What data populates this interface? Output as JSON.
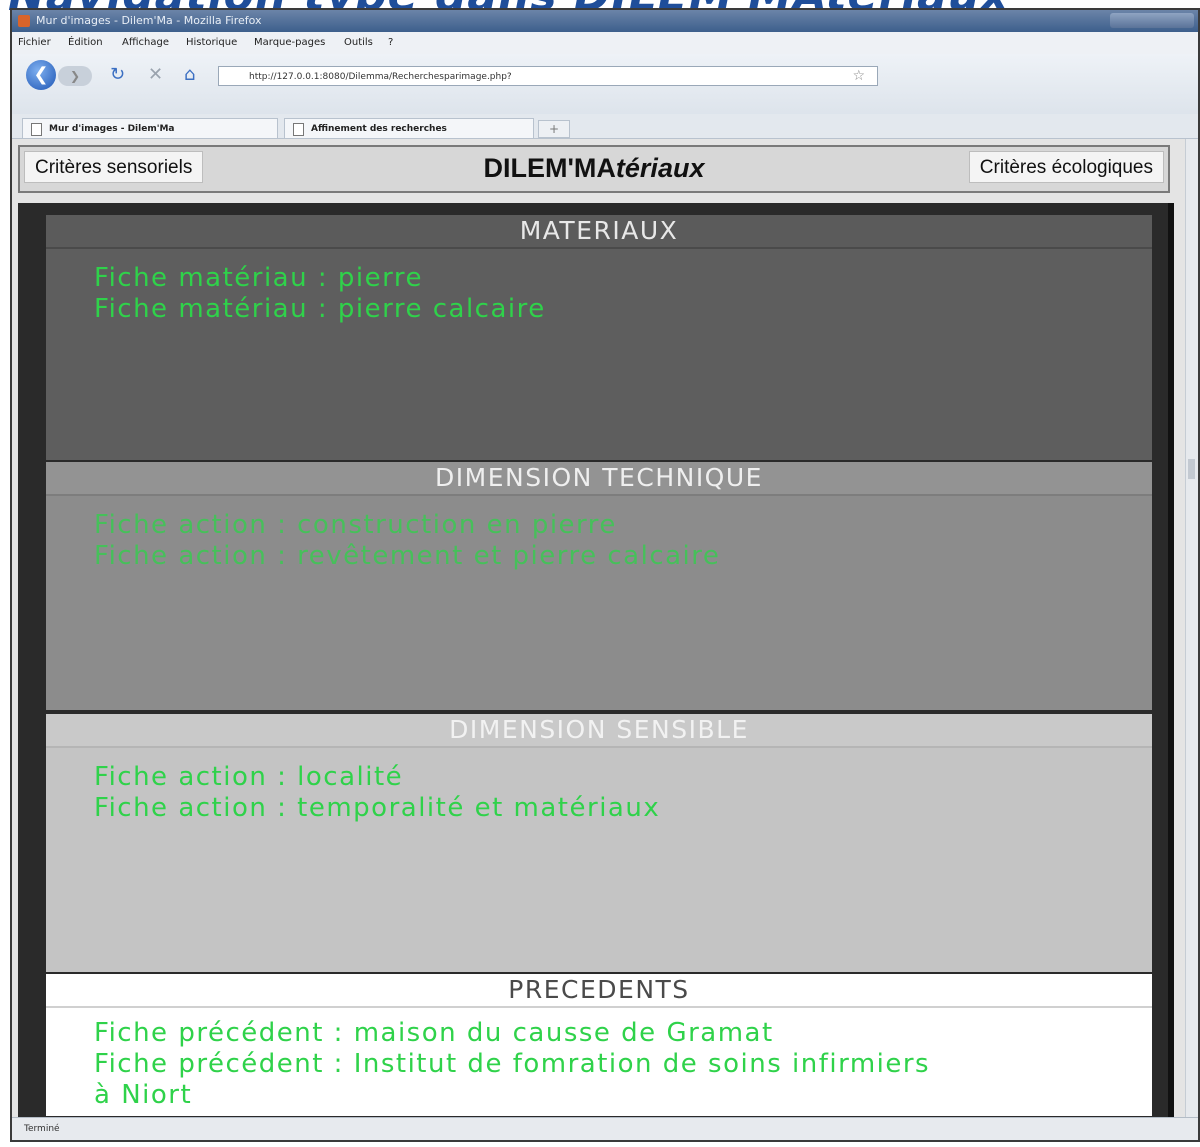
{
  "slide_title": "Navigation type dans DILEM'MAtériaux",
  "window": {
    "title": "Mur d'images - Dilem'Ma - Mozilla Firefox",
    "menu": [
      "Fichier",
      "Édition",
      "Affichage",
      "Historique",
      "Marque-pages",
      "Outils",
      "?"
    ],
    "url": "http://127.0.0.1:8080/Dilemma/Recherchesparimage.php?",
    "tabs": [
      {
        "label": "Mur d'images - Dilem'Ma"
      },
      {
        "label": "Affinement des recherches"
      }
    ],
    "new_tab_label": "+",
    "status": "Terminé"
  },
  "app": {
    "left_button": "Critères sensoriels",
    "brand_main": "DILEM'MA",
    "brand_italic": "tériaux",
    "right_button": "Critères écologiques"
  },
  "sections": [
    {
      "title": "MATERIAUX",
      "links": [
        "Fiche matériau : pierre",
        "Fiche matériau : pierre calcaire"
      ]
    },
    {
      "title": "DIMENSION TECHNIQUE",
      "links": [
        "Fiche action : construction en pierre",
        "Fiche action : revêtement et pierre calcaire"
      ]
    },
    {
      "title": "DIMENSION SENSIBLE",
      "links": [
        "Fiche action : localité",
        "Fiche action : temporalité et matériaux"
      ]
    },
    {
      "title": "PRECEDENTS",
      "links": [
        "Fiche précédent : maison du causse de Gramat",
        "Fiche précédent : Institut de fomration de soins infirmiers",
        "à Niort"
      ]
    }
  ],
  "colors": {
    "link_green": "#2fd24a",
    "materiaux_bg": "#5e5e5e",
    "technique_bg": "#8c8c8c",
    "sensible_bg": "#c4c4c4",
    "precedents_bg": "#ffffff",
    "slide_title": "#1f4e9a"
  },
  "icons": [
    "firefox-icon",
    "back-arrow-icon",
    "forward-arrow-icon",
    "reload-icon",
    "stop-icon",
    "home-icon",
    "bookmark-star-icon",
    "page-icon"
  ]
}
